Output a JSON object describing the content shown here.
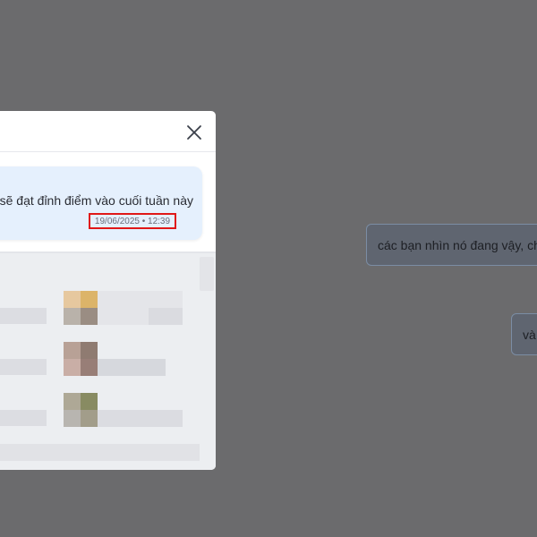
{
  "background": {
    "bubble_1_text": "các bạn nhìn nó đang vậy, ch",
    "bubble_2_text": "và"
  },
  "modal": {
    "close_icon": "close-icon",
    "message": {
      "text": "sẽ đạt đỉnh điểm vào cuối tuần này",
      "timestamp": "19/06/2025 • 12:39"
    }
  },
  "colors": {
    "overlay": "#6b6b6d",
    "message_bg": "#e5f0fd",
    "highlight_border": "#e01818"
  }
}
